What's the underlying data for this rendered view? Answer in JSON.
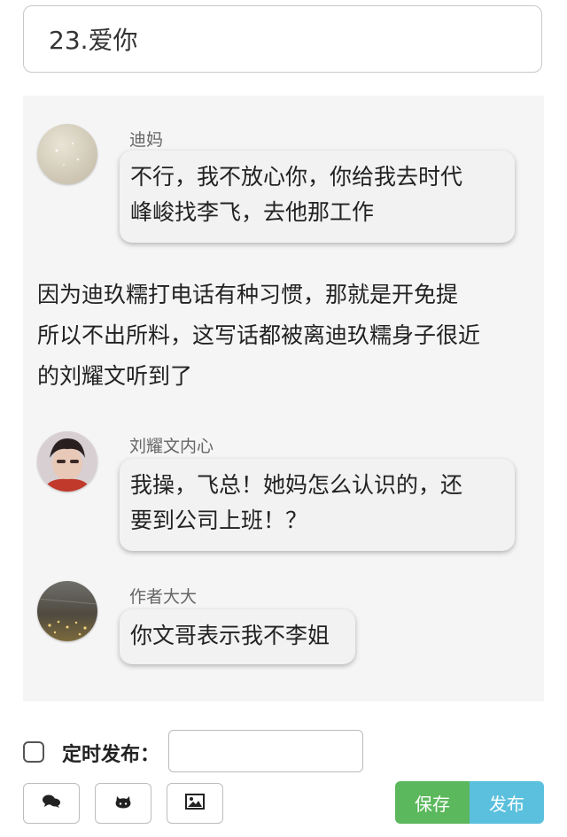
{
  "title_input": {
    "value": "23.爱你"
  },
  "messages": [
    {
      "sender": "迪妈",
      "text_lines": [
        "不行，我不放心你，你给我去时代",
        "峰峻找李飞，去他那工作"
      ]
    },
    {
      "sender": "刘耀文内心",
      "text_lines": [
        "我操，飞总！她妈怎么认识的，还",
        "要到公司上班！？"
      ]
    },
    {
      "sender": "作者大大",
      "text_lines": [
        "你文哥表示我不李姐"
      ]
    }
  ],
  "narration": {
    "lines": [
      "因为迪玖糯打电话有种习惯，那就是开免提",
      "所以不出所料，这写话都被离迪玖糯身子很近",
      "的刘耀文听到了"
    ]
  },
  "schedule": {
    "label": "定时发布：",
    "value": ""
  },
  "toolbar": {
    "icons": [
      "chat-bubbles-icon",
      "github-icon",
      "image-icon"
    ]
  },
  "actions": {
    "save_label": "保存",
    "publish_label": "发布"
  },
  "colors": {
    "save": "#5cb85c",
    "publish": "#5bc0de",
    "chat_bg": "#f5f5f5"
  }
}
